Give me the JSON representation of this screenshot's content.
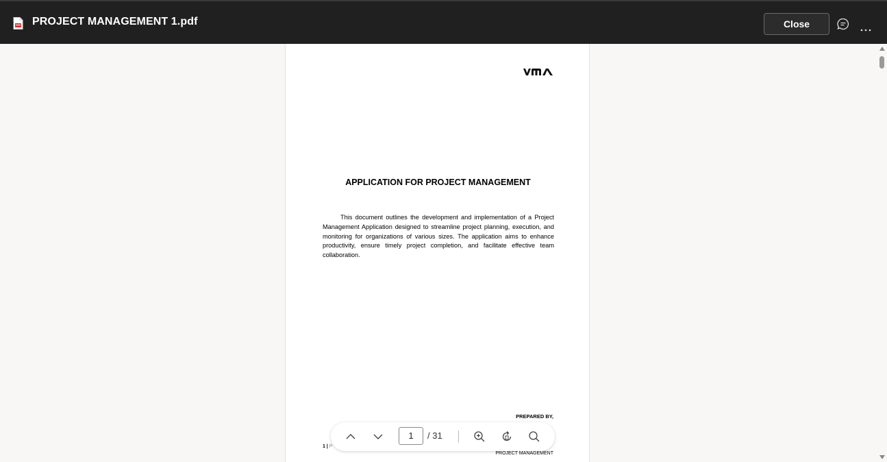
{
  "header": {
    "file_title": "PROJECT MANAGEMENT 1.pdf",
    "close_label": "Close",
    "icons": [
      "pdf-file-icon",
      "comment-icon",
      "more-options-icon"
    ]
  },
  "document": {
    "logo_text": "VMA",
    "title": "APPLICATION FOR PROJECT MANAGEMENT",
    "body": "This document outlines the development and implementation of a Project Management Application designed to streamline project planning, execution, and monitoring for organizations of various sizes. The application aims to enhance productivity, ensure timely project completion, and facilitate effective team collaboration.",
    "prepared_by": "PREPARED BY,",
    "footer_page_number": "1 |",
    "footer_partial": "P",
    "footer_right": "PROJECT MANAGEMENT"
  },
  "toolbar": {
    "current_page": "1",
    "total_pages": "/ 31",
    "icons": [
      "previous-page-icon",
      "next-page-icon",
      "zoom-in-icon",
      "rotate-icon",
      "search-icon"
    ]
  },
  "colors": {
    "header_bg": "#202020",
    "viewer_bg": "#f8f7f6",
    "page_bg": "#ffffff"
  }
}
